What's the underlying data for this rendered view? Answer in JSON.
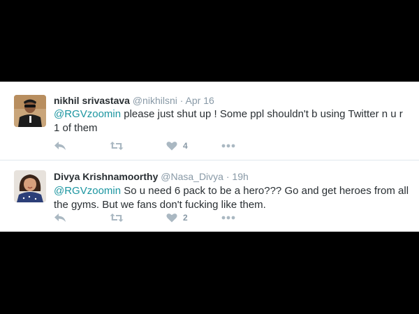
{
  "tweets": [
    {
      "name": "nikhil srivastava",
      "handle": "@nikhilsni",
      "separator": "·",
      "time": "Apr 16",
      "mention": "@RGVzoomin",
      "text": " please just shut up ! Some ppl shouldn't b using Twitter n u r 1 of them",
      "like_count": "4",
      "icons": [
        "reply-icon",
        "retweet-icon",
        "heart-icon",
        "more-icon"
      ]
    },
    {
      "name": "Divya Krishnamoorthy",
      "handle": "@Nasa_Divya",
      "separator": "·",
      "time": "19h",
      "mention": "@RGVzoomin",
      "text": " So u need 6 pack to be a hero??? Go and get heroes from all the gyms. But we fans don't fucking like them.",
      "like_count": "2",
      "icons": [
        "reply-icon",
        "retweet-icon",
        "heart-icon",
        "more-icon"
      ]
    }
  ],
  "colors": {
    "background_band": "#000000",
    "card": "#ffffff",
    "mention": "#1b95a0",
    "muted": "#8899a6",
    "icon": "#aab8c2"
  }
}
